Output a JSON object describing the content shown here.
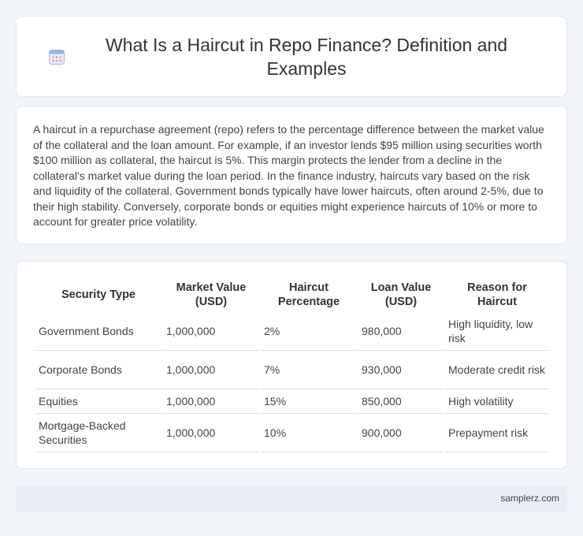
{
  "header": {
    "title": "What Is a Haircut in Repo Finance? Definition and Examples",
    "icon": "calendar-icon"
  },
  "intro": {
    "text": "A haircut in a repurchase agreement (repo) refers to the percentage difference between the market value of the collateral and the loan amount. For example, if an investor lends $95 million using securities worth $100 million as collateral, the haircut is 5%. This margin protects the lender from a decline in the collateral's market value during the loan period. In the finance industry, haircuts vary based on the risk and liquidity of the collateral. Government bonds typically have lower haircuts, often around 2-5%, due to their high stability. Conversely, corporate bonds or equities might experience haircuts of 10% or more to account for greater price volatility."
  },
  "table": {
    "headers": [
      "Security Type",
      "Market Value (USD)",
      "Haircut Percentage",
      "Loan Value (USD)",
      "Reason for Haircut"
    ],
    "rows": [
      [
        "Government Bonds",
        "1,000,000",
        "2%",
        "980,000",
        "High liquidity, low risk"
      ],
      [
        "Corporate Bonds",
        "1,000,000",
        "7%",
        "930,000",
        "Moderate credit risk"
      ],
      [
        "Equities",
        "1,000,000",
        "15%",
        "850,000",
        "High volatility"
      ],
      [
        "Mortgage-Backed Securities",
        "1,000,000",
        "10%",
        "900,000",
        "Prepayment risk"
      ]
    ]
  },
  "footer": {
    "site": "samplerz.com"
  },
  "colors": {
    "background": "#f1f4f9",
    "card": "#ffffff",
    "footer_bg": "#e8edf6"
  }
}
